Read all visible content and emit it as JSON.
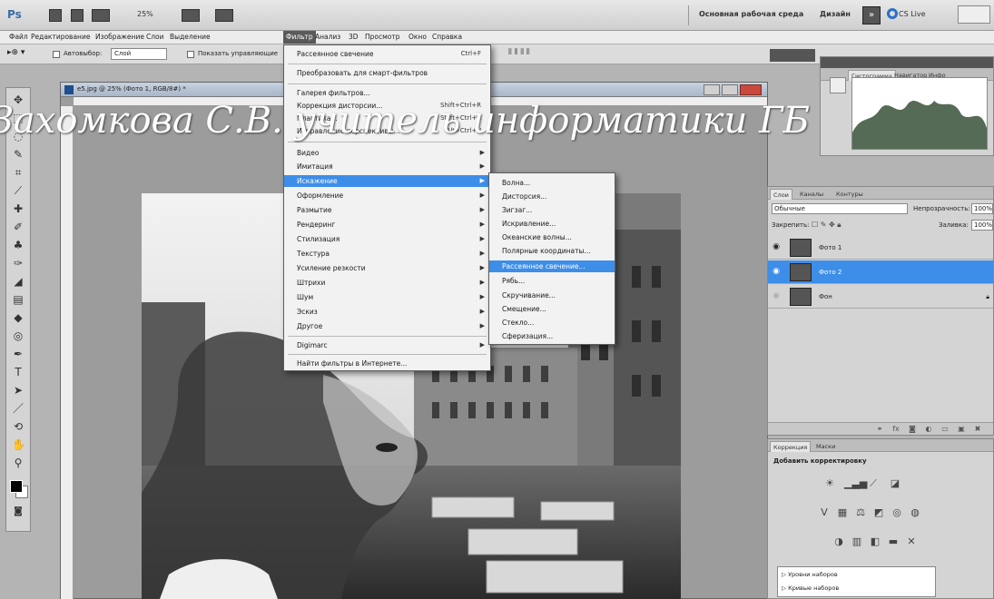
{
  "app": {
    "logo": "Ps",
    "zoom": "25%",
    "workspace_label": "Основная рабочая среда",
    "design_label": "Дизайн",
    "more_label": "»",
    "cslive_label": "CS Live"
  },
  "menubar": {
    "items": [
      "Файл",
      "Редактирование",
      "Изображение",
      "Слои",
      "Выделение",
      "Фильтр",
      "Анализ",
      "3D",
      "Просмотр",
      "Окно",
      "Справка"
    ],
    "active_index": 5
  },
  "options": {
    "autoselect_label": "Автовыбор:",
    "autoselect_value": "Слой",
    "show_controls_label": "Показать управляющие"
  },
  "document": {
    "title": "e5.jpg @ 25% (Фото 1, RGB/8#) *"
  },
  "watermark": "Захомкова С.В. учитель информатики ГБ",
  "filter_menu": {
    "items": [
      {
        "label": "Рассеянное свечение",
        "shortcut": "Ctrl+F"
      },
      {
        "label": "Преобразовать для смарт-фильтров"
      },
      {
        "label": "Галерея фильтров..."
      },
      {
        "label": "Коррекция дисторсии...",
        "shortcut": "Shift+Ctrl+R"
      },
      {
        "label": "Пластика...",
        "shortcut": "Shift+Ctrl+X"
      },
      {
        "label": "Исправление перспективы...",
        "shortcut": "Alt+Ctrl+V"
      },
      {
        "label": "Видео"
      },
      {
        "label": "Имитация"
      },
      {
        "label": "Искажение"
      },
      {
        "label": "Оформление"
      },
      {
        "label": "Размытие"
      },
      {
        "label": "Рендеринг"
      },
      {
        "label": "Стилизация"
      },
      {
        "label": "Текстура"
      },
      {
        "label": "Усиление резкости"
      },
      {
        "label": "Штрихи"
      },
      {
        "label": "Шум"
      },
      {
        "label": "Эскиз"
      },
      {
        "label": "Другое"
      },
      {
        "label": "Digimarc"
      },
      {
        "label": "Найти фильтры в Интернете..."
      }
    ],
    "highlight_index": 8
  },
  "distort_menu": {
    "items": [
      "Волна...",
      "Дисторсия...",
      "Зигзаг...",
      "Искривление...",
      "Океанские волны...",
      "Полярные координаты...",
      "Рассеянное свечение...",
      "Рябь...",
      "Скручивание...",
      "Смещение...",
      "Стекло...",
      "Сферизация..."
    ],
    "highlight_index": 6
  },
  "histogram_panel": {
    "tabs": [
      "Гистограмма",
      "Навигатор",
      "Инфо"
    ]
  },
  "layers_panel": {
    "tabs": [
      "Слои",
      "Каналы",
      "Контуры"
    ],
    "blend_mode": "Обычные",
    "opacity_label": "Непрозрачность:",
    "opacity_value": "100%",
    "lock_label": "Закрепить:",
    "fill_label": "Заливка:",
    "fill_value": "100%",
    "layers": [
      {
        "name": "Фото 1",
        "visible": true,
        "active": false
      },
      {
        "name": "Фото 2",
        "visible": true,
        "active": true
      },
      {
        "name": "Фон",
        "visible": false,
        "active": false,
        "locked": true
      }
    ]
  },
  "adjustments_panel": {
    "tabs": [
      "Коррекция",
      "Маски"
    ],
    "title": "Добавить корректировку",
    "presets": [
      "Уровни наборов",
      "Кривые наборов"
    ]
  },
  "colors": {
    "highlight": "#3d8ee8",
    "menu_bg": "#f2f2f2"
  }
}
